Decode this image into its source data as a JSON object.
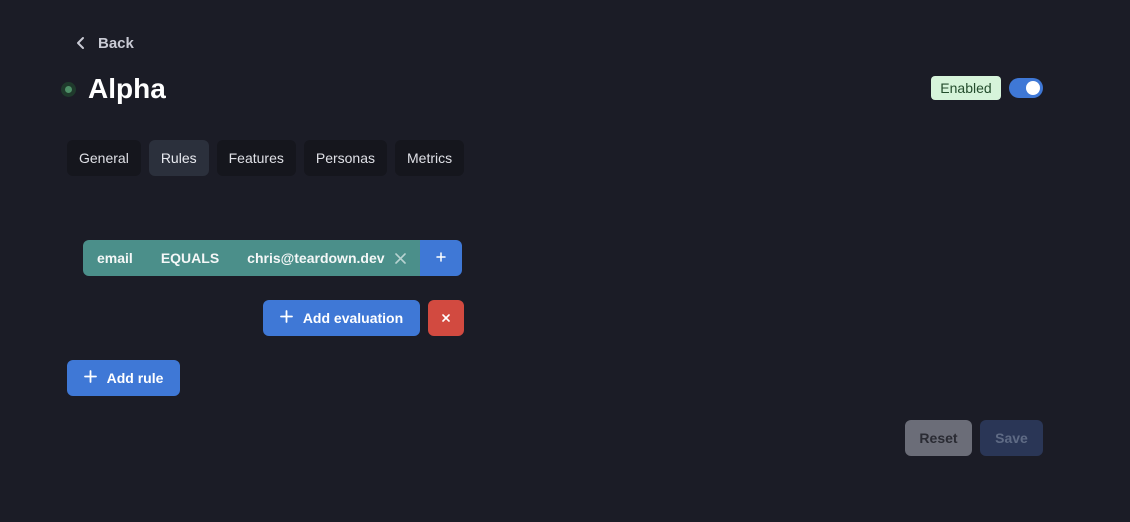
{
  "header": {
    "back_label": "Back",
    "title": "Alpha",
    "status_badge": "Enabled",
    "toggle_on": true
  },
  "tabs": [
    {
      "label": "General",
      "active": false
    },
    {
      "label": "Rules",
      "active": true
    },
    {
      "label": "Features",
      "active": false
    },
    {
      "label": "Personas",
      "active": false
    },
    {
      "label": "Metrics",
      "active": false
    }
  ],
  "rule": {
    "field": "email",
    "operator": "EQUALS",
    "value": "chris@teardown.dev",
    "add_label": "+"
  },
  "actions": {
    "add_evaluation": "Add evaluation",
    "delete": "×",
    "add_rule": "Add rule",
    "reset": "Reset",
    "save": "Save"
  },
  "icons": {
    "back": "chevron-left-icon",
    "status": "status-dot-icon",
    "remove": "close-icon",
    "plus": "plus-icon"
  },
  "colors": {
    "background": "#1b1c26",
    "accent": "#3f78d6",
    "rule_pill": "#4b8f8a",
    "danger": "#d24a40",
    "enabled_badge_bg": "#d6f4da"
  }
}
